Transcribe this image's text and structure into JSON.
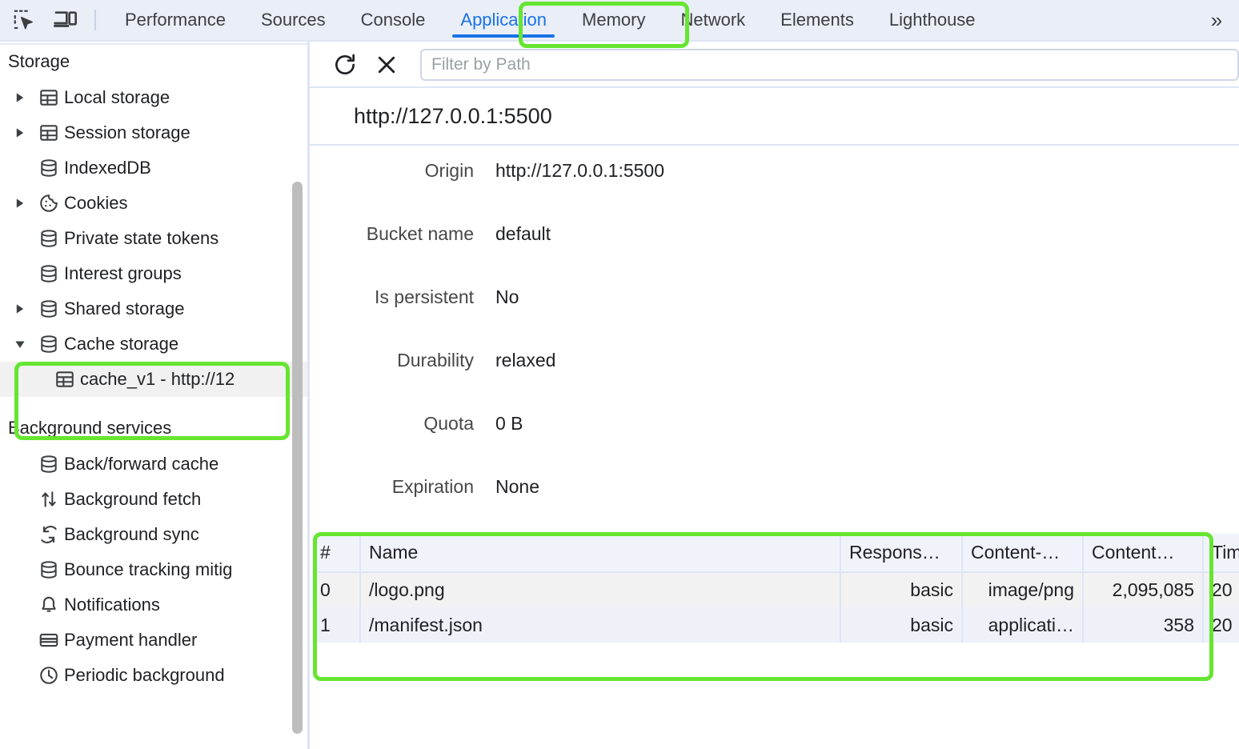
{
  "toolbar_icons": {
    "inspect": "inspect-element-icon",
    "device": "device-toolbar-icon",
    "more": "»"
  },
  "tabs": [
    {
      "label": "Performance",
      "active": false
    },
    {
      "label": "Sources",
      "active": false
    },
    {
      "label": "Console",
      "active": false
    },
    {
      "label": "Application",
      "active": true
    },
    {
      "label": "Memory",
      "active": false
    },
    {
      "label": "Network",
      "active": false
    },
    {
      "label": "Elements",
      "active": false
    },
    {
      "label": "Lighthouse",
      "active": false
    }
  ],
  "sidebar": {
    "sections": [
      {
        "title": "Storage",
        "items": [
          {
            "label": "Local storage",
            "icon": "table-icon",
            "expander": "collapsed",
            "selected": false,
            "indent": false
          },
          {
            "label": "Session storage",
            "icon": "table-icon",
            "expander": "collapsed",
            "selected": false,
            "indent": false
          },
          {
            "label": "IndexedDB",
            "icon": "database-icon",
            "expander": "none",
            "selected": false,
            "indent": false
          },
          {
            "label": "Cookies",
            "icon": "cookie-icon",
            "expander": "collapsed",
            "selected": false,
            "indent": false
          },
          {
            "label": "Private state tokens",
            "icon": "database-icon",
            "expander": "none",
            "selected": false,
            "indent": false
          },
          {
            "label": "Interest groups",
            "icon": "database-icon",
            "expander": "none",
            "selected": false,
            "indent": false
          },
          {
            "label": "Shared storage",
            "icon": "database-icon",
            "expander": "collapsed",
            "selected": false,
            "indent": false
          },
          {
            "label": "Cache storage",
            "icon": "database-icon",
            "expander": "expanded",
            "selected": false,
            "indent": false
          },
          {
            "label": "cache_v1 - http://12",
            "icon": "table-icon",
            "expander": "none",
            "selected": true,
            "indent": true
          }
        ]
      },
      {
        "title": "Background services",
        "items": [
          {
            "label": "Back/forward cache",
            "icon": "database-icon",
            "expander": "none",
            "selected": false,
            "indent": false
          },
          {
            "label": "Background fetch",
            "icon": "updown-arrows-icon",
            "expander": "none",
            "selected": false,
            "indent": false
          },
          {
            "label": "Background sync",
            "icon": "sync-icon",
            "expander": "none",
            "selected": false,
            "indent": false
          },
          {
            "label": "Bounce tracking mitig",
            "icon": "database-icon",
            "expander": "none",
            "selected": false,
            "indent": false
          },
          {
            "label": "Notifications",
            "icon": "bell-icon",
            "expander": "none",
            "selected": false,
            "indent": false
          },
          {
            "label": "Payment handler",
            "icon": "credit-card-icon",
            "expander": "none",
            "selected": false,
            "indent": false
          },
          {
            "label": "Periodic background",
            "icon": "clock-icon",
            "expander": "none",
            "selected": false,
            "indent": false
          }
        ]
      }
    ]
  },
  "main": {
    "toolbar": {
      "refresh_icon": "refresh-icon",
      "clear_icon": "clear-icon",
      "filter_placeholder": "Filter by Path",
      "filter_value": ""
    },
    "title": "http://127.0.0.1:5500",
    "metadata": [
      {
        "key": "Origin",
        "value": "http://127.0.0.1:5500"
      },
      {
        "key": "Bucket name",
        "value": "default"
      },
      {
        "key": "Is persistent",
        "value": "No"
      },
      {
        "key": "Durability",
        "value": "relaxed"
      },
      {
        "key": "Quota",
        "value": "0 B"
      },
      {
        "key": "Expiration",
        "value": "None"
      }
    ],
    "table": {
      "columns": [
        {
          "label": "#",
          "align": "left"
        },
        {
          "label": "Name",
          "align": "left"
        },
        {
          "label": "Respons…",
          "align": "right"
        },
        {
          "label": "Content-…",
          "align": "right"
        },
        {
          "label": "Content…",
          "align": "right"
        },
        {
          "label": "Tim",
          "align": "left"
        }
      ],
      "rows": [
        {
          "index": "0",
          "name": "/logo.png",
          "response_type": "basic",
          "content_type": "image/png",
          "content_length": "2,095,085",
          "time": "20"
        },
        {
          "index": "1",
          "name": "/manifest.json",
          "response_type": "basic",
          "content_type": "applicati…",
          "content_length": "358",
          "time": "20"
        }
      ]
    }
  },
  "annotations": {
    "highlight_color": "#66e531",
    "targets": [
      "application-tab",
      "cache-storage-group",
      "cache-entries-table"
    ]
  }
}
